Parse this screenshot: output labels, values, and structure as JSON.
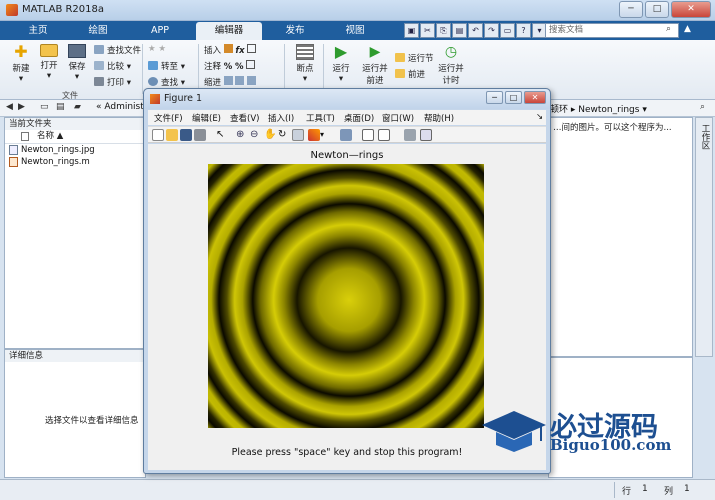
{
  "window": {
    "title": "MATLAB R2018a",
    "min": "─",
    "max": "□",
    "close": "✕"
  },
  "tabs": [
    {
      "label": "主页"
    },
    {
      "label": "绘图"
    },
    {
      "label": "APP"
    },
    {
      "label": "编辑器"
    },
    {
      "label": "发布"
    },
    {
      "label": "视图"
    }
  ],
  "search": {
    "placeholder": "搜索文档"
  },
  "ribbon": {
    "new": "新建",
    "open": "打开",
    "save": "保存",
    "find_files": "查找文件",
    "compare": "比较",
    "print": "打印",
    "group_file": "文件",
    "goto": "转至",
    "find": "查找",
    "insert": "插入",
    "comment": "注释",
    "indent": "缩进",
    "breakpoints": "断点",
    "run": "运行",
    "run_advance": "运行并前进",
    "run_section": "运行节",
    "advance": "前进",
    "run_time": "运行并计时",
    "run_advance_l1": "运行并",
    "run_advance_l2": "前进",
    "run_time_l1": "运行并",
    "run_time_l2": "计时"
  },
  "address": {
    "path": "« Administra",
    "path_right_prefix": "的牛顿环 ▸",
    "path_right": "Newton_rings"
  },
  "current_folder": {
    "title": "当前文件夹",
    "column": "名称 ▲",
    "files": [
      {
        "name": "Newton_rings.jpg"
      },
      {
        "name": "Newton_rings.m"
      }
    ]
  },
  "details": {
    "title": "详细信息",
    "message": "选择文件以查看详细信息"
  },
  "editor_text": "…间的图片。可以这个程序为...",
  "workspace_vertical": "工作区",
  "status": {
    "row_label": "行",
    "row": "1",
    "col_label": "列",
    "col": "1"
  },
  "figure": {
    "title": "Figure 1",
    "menus": [
      "文件(F)",
      "编辑(E)",
      "查看(V)",
      "插入(I)",
      "工具(T)",
      "桌面(D)",
      "窗口(W)",
      "帮助(H)"
    ],
    "plot_title": "Newton—rings",
    "message": "Please press \"space\" key and stop this program!"
  },
  "watermark": {
    "text": "必过源码",
    "url": "Biguo100.com"
  },
  "colors": {
    "ring_yellow": "#c8c000",
    "ring_dark": "#0a0a00",
    "ribbon_blue": "#1f5e9e"
  }
}
